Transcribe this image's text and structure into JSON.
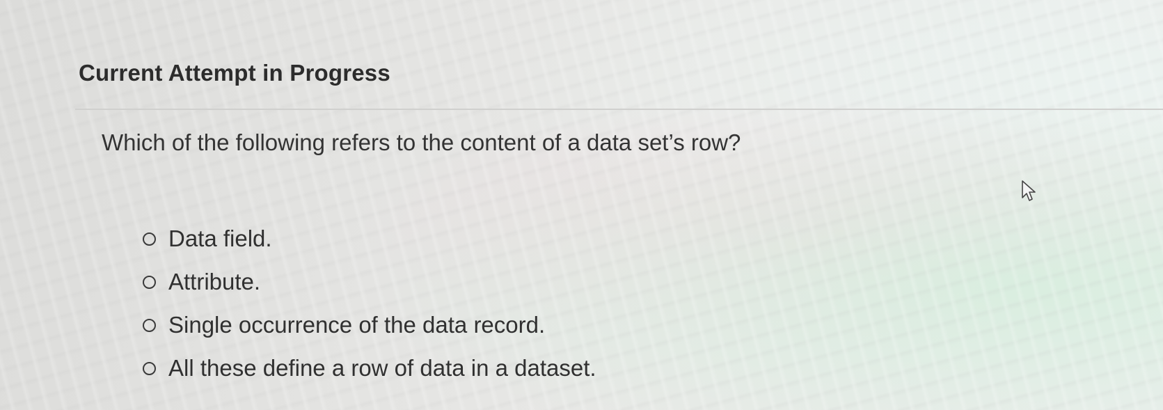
{
  "quiz": {
    "status_title": "Current Attempt in Progress",
    "question": "Which of the following refers to the content of a data set’s row?",
    "options": [
      {
        "label": "Data field."
      },
      {
        "label": "Attribute."
      },
      {
        "label": "Single occurrence of the data record."
      },
      {
        "label": "All these define a row of data in a dataset."
      }
    ]
  },
  "icons": {
    "cursor": "mouse-pointer-icon",
    "radio": "radio-button-empty-icon"
  }
}
